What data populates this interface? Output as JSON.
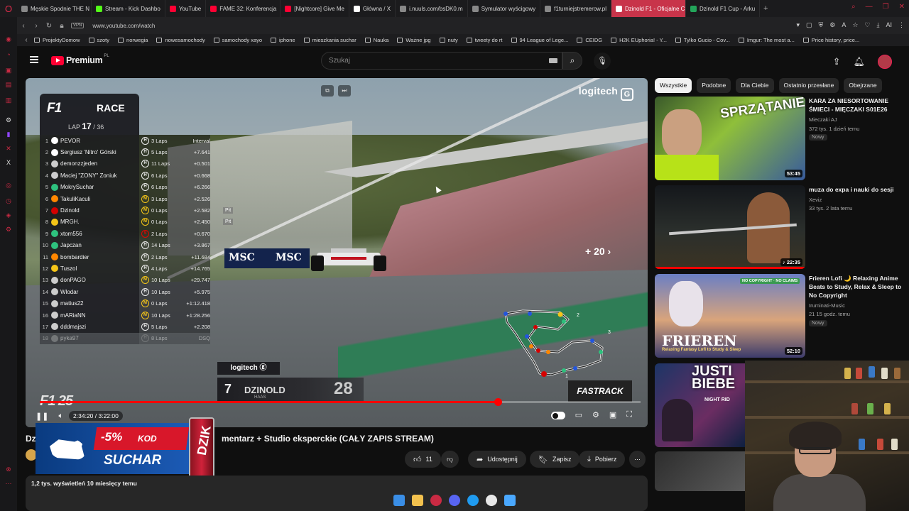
{
  "browser": {
    "tabs": [
      {
        "label": "Męskie Spodnie THE N",
        "color": "#888888"
      },
      {
        "label": "Stream - Kick Dashbo",
        "color": "#53fc18"
      },
      {
        "label": "YouTube",
        "color": "#ff0033"
      },
      {
        "label": "FAME 32: Konferencja",
        "color": "#ff0033"
      },
      {
        "label": "[Nightcore] Give Me",
        "color": "#ff0033"
      },
      {
        "label": "Główna / X",
        "color": "#ffffff"
      },
      {
        "label": "i.nuuls.com/bsDK0.m",
        "color": "#888888"
      },
      {
        "label": "Symulator wyścigowy",
        "color": "#888888"
      },
      {
        "label": "f1turniejstremerow.pl",
        "color": "#888888"
      },
      {
        "label": "Dzinold F1 - Oficjalne C",
        "color": "#ffffff"
      },
      {
        "label": "Dzinold F1 Cup - Arku",
        "color": "#23a55a"
      }
    ],
    "active_tab_index": 9,
    "vpn_label": "VPN",
    "url": "www.youtube.com/watch",
    "bookmarks": [
      "ProjektyDomow",
      "szoty",
      "norwegia",
      "nowesamochody",
      "samochody xayo",
      "iphone",
      "mieszkania suchar",
      "Nauka",
      "Ważne jpg",
      "nuty",
      "tweety do rt",
      "94 League of Lege...",
      "CEIDG",
      "H2K EUphoria! - Y...",
      "Tylko Gucio - Cov...",
      "Imgur: The most a...",
      "Price history, price..."
    ]
  },
  "youtube": {
    "brand": "Premium",
    "region": "PL",
    "search_placeholder": "Szukaj"
  },
  "player": {
    "logitech": "logitech",
    "skip_label": "+ 20",
    "time": "2:34:20 / 3:22:00",
    "progress_fraction": 0.762,
    "f1": {
      "f1_logo": "F1",
      "race_label": "RACE",
      "lap_prefix": "LAP",
      "lap_current": "17",
      "lap_total": "/ 36",
      "rows": [
        {
          "pos": "1",
          "name": "PEVOR",
          "tyre": "H",
          "laps": "3 Laps",
          "gap": "Interval",
          "team": "#ffffff",
          "tyre_color": "#eeeeee"
        },
        {
          "pos": "2",
          "name": "Sergiusz 'Nitro' Górski",
          "tyre": "H",
          "laps": "5 Laps",
          "gap": "+7.641",
          "team": "#ffffff",
          "tyre_color": "#eeeeee"
        },
        {
          "pos": "3",
          "name": "demonzzjeden",
          "tyre": "H",
          "laps": "11 Laps",
          "gap": "+0.501",
          "team": "#cccccc",
          "tyre_color": "#eeeeee"
        },
        {
          "pos": "4",
          "name": "Maciej \"ZONY\" Zoniuk",
          "tyre": "H",
          "laps": "6 Laps",
          "gap": "+0.668",
          "team": "#cccccc",
          "tyre_color": "#eeeeee"
        },
        {
          "pos": "5",
          "name": "MokrySuchar",
          "tyre": "H",
          "laps": "6 Laps",
          "gap": "+6.266",
          "team": "#2ec27e",
          "tyre_color": "#eeeeee"
        },
        {
          "pos": "6",
          "name": "TakuliKaculi",
          "tyre": "M",
          "laps": "3 Laps",
          "gap": "+2.526",
          "team": "#ff8700",
          "tyre_color": "#f5c518"
        },
        {
          "pos": "7",
          "name": "Dzinold",
          "tyre": "M",
          "laps": "0 Laps",
          "gap": "+2.582",
          "team": "#d40000",
          "tyre_color": "#f5c518",
          "pit": "Pit"
        },
        {
          "pos": "8",
          "name": "MRGH.",
          "tyre": "M",
          "laps": "0 Laps",
          "gap": "+2.450",
          "team": "#f5c518",
          "tyre_color": "#f5c518",
          "pit": "Pit"
        },
        {
          "pos": "9",
          "name": "xtom556",
          "tyre": "S",
          "laps": "2 Laps",
          "gap": "+0.670",
          "team": "#2ec27e",
          "tyre_color": "#e10600"
        },
        {
          "pos": "10",
          "name": "Japczan",
          "tyre": "H",
          "laps": "14 Laps",
          "gap": "+3.867",
          "team": "#2ec27e",
          "tyre_color": "#eeeeee"
        },
        {
          "pos": "11",
          "name": "bombardier",
          "tyre": "H",
          "laps": "2 Laps",
          "gap": "+11.684",
          "team": "#ff8700",
          "tyre_color": "#eeeeee"
        },
        {
          "pos": "12",
          "name": "Tuszol",
          "tyre": "H",
          "laps": "4 Laps",
          "gap": "+14.765",
          "team": "#f5c518",
          "tyre_color": "#eeeeee"
        },
        {
          "pos": "13",
          "name": "donPAGO",
          "tyre": "M",
          "laps": "10 Laps",
          "gap": "+29.747",
          "team": "#cccccc",
          "tyre_color": "#f5c518"
        },
        {
          "pos": "14",
          "name": "Wlodar",
          "tyre": "H",
          "laps": "10 Laps",
          "gap": "+5.975",
          "team": "#cccccc",
          "tyre_color": "#eeeeee"
        },
        {
          "pos": "15",
          "name": "matius22",
          "tyre": "M",
          "laps": "0 Laps",
          "gap": "+1:12.418",
          "team": "#cccccc",
          "tyre_color": "#f5c518"
        },
        {
          "pos": "16",
          "name": "mARiaNN",
          "tyre": "M",
          "laps": "10 Laps",
          "gap": "+1:28.256",
          "team": "#cccccc",
          "tyre_color": "#f5c518"
        },
        {
          "pos": "17",
          "name": "dddmajszi",
          "tyre": "H",
          "laps": "5 Laps",
          "gap": "+2.208",
          "team": "#cccccc",
          "tyre_color": "#eeeeee"
        },
        {
          "pos": "18",
          "name": "pyka97",
          "tyre": "H",
          "laps": "8 Laps",
          "gap": "DSQ",
          "team": "#888888",
          "tyre_color": "#888888",
          "dim": true
        }
      ]
    },
    "driver": {
      "number": "7",
      "name": "DZINOLD",
      "team": "HAAS",
      "laps": "28"
    },
    "fastrack": "FASTRACK",
    "minimap_labels": [
      "1",
      "2",
      "3"
    ]
  },
  "video": {
    "title_prefix": "Dz",
    "title_rest": "mentarz + Studio eksperckie (CAŁY ZAPIS STREAM)",
    "likes": "11",
    "share": "Udostępnij",
    "save": "Zapisz",
    "download": "Pobierz",
    "meta": "1,2 tys. wyświetleń  10 miesięcy temu"
  },
  "ad": {
    "discount": "-5%",
    "code_label": "KOD",
    "code": "SUCHAR",
    "can_text": "DZIK"
  },
  "sidebar": {
    "chips": [
      "Wszystkie",
      "Podobne",
      "Dla Ciebie",
      "Ostatnio przesłane",
      "Obejrzane"
    ],
    "recs": [
      {
        "title": "KARA ZA NIESORTOWANIE ŚMIECI - MIĘCZAKI S01E26",
        "channel": "Mieczaki AJ",
        "views": "372 tys.  1 dzień temu",
        "badge": "Nowy",
        "duration": "53:45",
        "thumb_text": "SPRZĄTANIE"
      },
      {
        "title": "muza do expa i nauki do sesji",
        "channel": "Xeviz",
        "views": "33 tys.  2 lata temu",
        "badge": "",
        "duration": "22:35",
        "thumb_text": ""
      },
      {
        "title": "Frieren Lofi 🌙 Relaxing Anime Beats to Study, Relax & Sleep to No Copyright",
        "channel": "Iruminati-Music",
        "views": "21  15 godz. temu",
        "badge": "Nowy",
        "duration": "52:10",
        "thumb_text": "FRIEREN",
        "thumb_sub": "Relaxing Fantasy Lofi to Study & Sleep",
        "thumb_tag": "NO COPYRIGHT · NO CLAIMS"
      },
      {
        "title": "",
        "channel": "",
        "views": "",
        "badge": "",
        "duration": "",
        "thumb_text": "JUSTI BIEBE",
        "thumb_sub": "NIGHT RID"
      }
    ]
  }
}
